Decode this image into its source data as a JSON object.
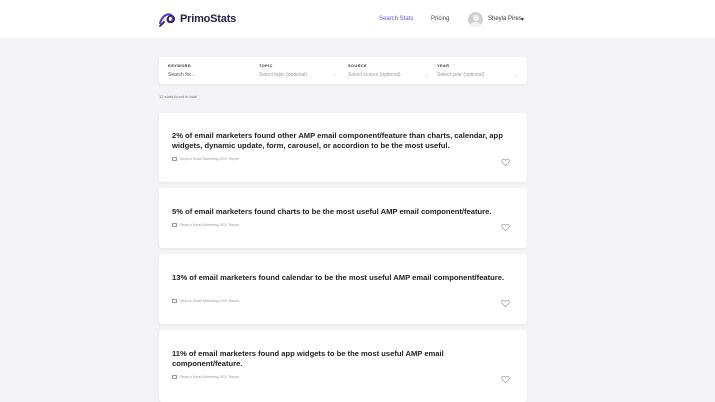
{
  "header": {
    "logo_text": "PrimoStats",
    "nav": [
      {
        "label": "Search Stats",
        "active": true
      },
      {
        "label": "Pricing",
        "active": false
      }
    ],
    "user_name": "Sheyla Pires"
  },
  "filters": [
    {
      "label": "KEYWORD",
      "value": "Search for..."
    },
    {
      "label": "TOPIC",
      "value": "Select topic (optional)"
    },
    {
      "label": "SOURCE",
      "value": "Select source (optional)"
    },
    {
      "label": "YEAR",
      "value": "Select year (optional)"
    }
  ],
  "result_count": "12 stats found in total",
  "cards": [
    {
      "title": "2% of email marketers found other AMP email component/feature than charts, calendar, app widgets, dynamic update, form, carousel, or accordion to be the most useful.",
      "source": "Stripo's Email Marketing 2021 Report"
    },
    {
      "title": "5% of email marketers found charts to be the most useful AMP email component/feature.",
      "source": "Stripo's Email Marketing 2021 Report"
    },
    {
      "title": "13% of email marketers found calendar to be the most useful AMP email component/feature.",
      "source": "Stripo's Email Marketing 2021 Report"
    },
    {
      "title": "11% of email marketers found app widgets to be the most useful AMP email component/feature.",
      "source": "Stripo's Email Marketing 2021 Report"
    }
  ],
  "colors": {
    "accent": "#6b4fe0",
    "page_background": "#f3f3f5",
    "card_background": "#ffffff"
  },
  "icons": [
    "logo-icon",
    "avatar",
    "chevron-down-icon",
    "document-icon",
    "heart-icon"
  ]
}
